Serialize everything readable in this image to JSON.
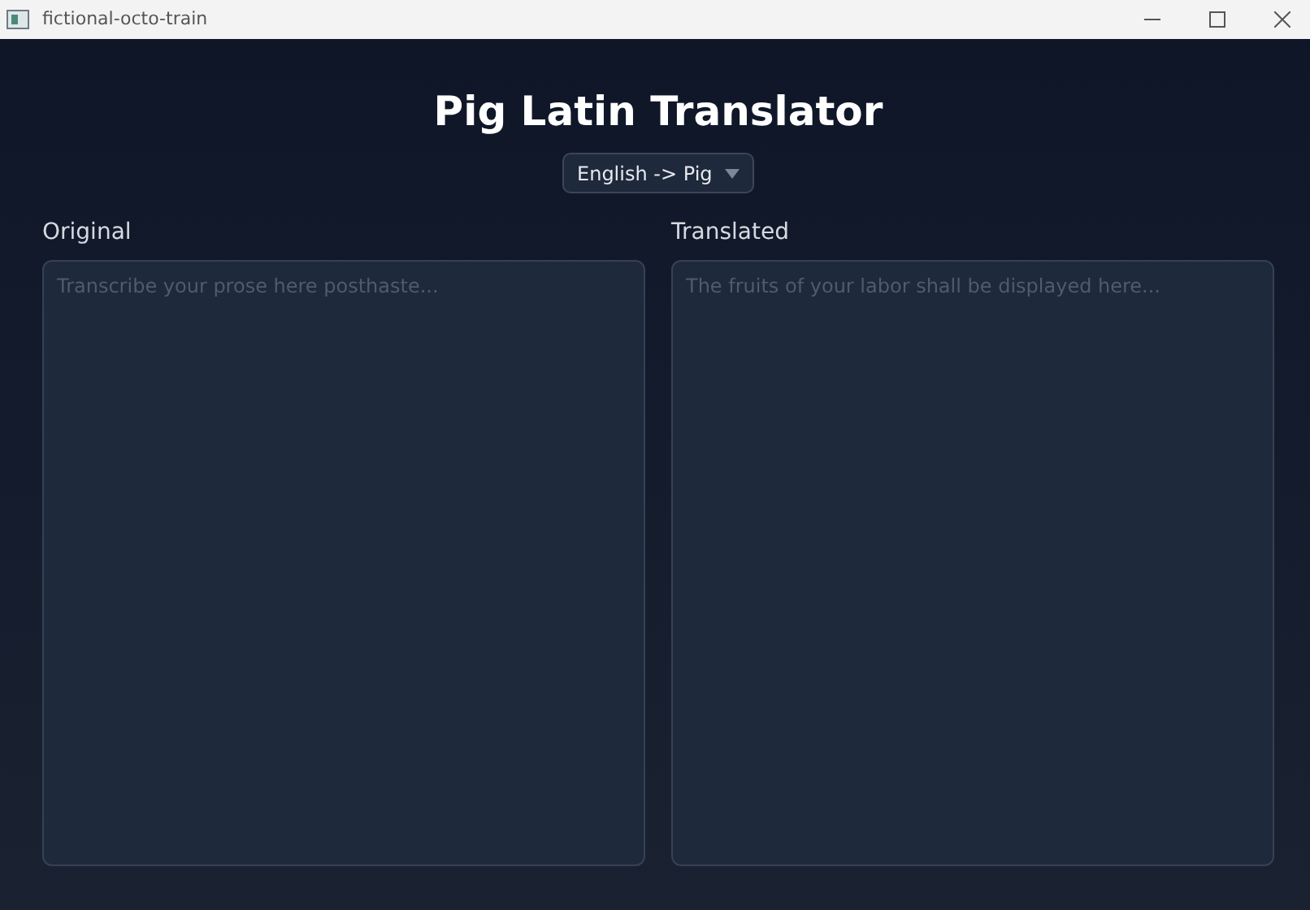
{
  "window": {
    "title": "fictional-octo-train"
  },
  "heading": "Pig Latin Translator",
  "mode_select": {
    "value": "English -> Pig"
  },
  "panes": [
    {
      "label": "Original",
      "placeholder": "Transcribe your prose here posthaste..."
    },
    {
      "label": "Translated",
      "placeholder": "The fruits of your labor shall be displayed here..."
    }
  ]
}
